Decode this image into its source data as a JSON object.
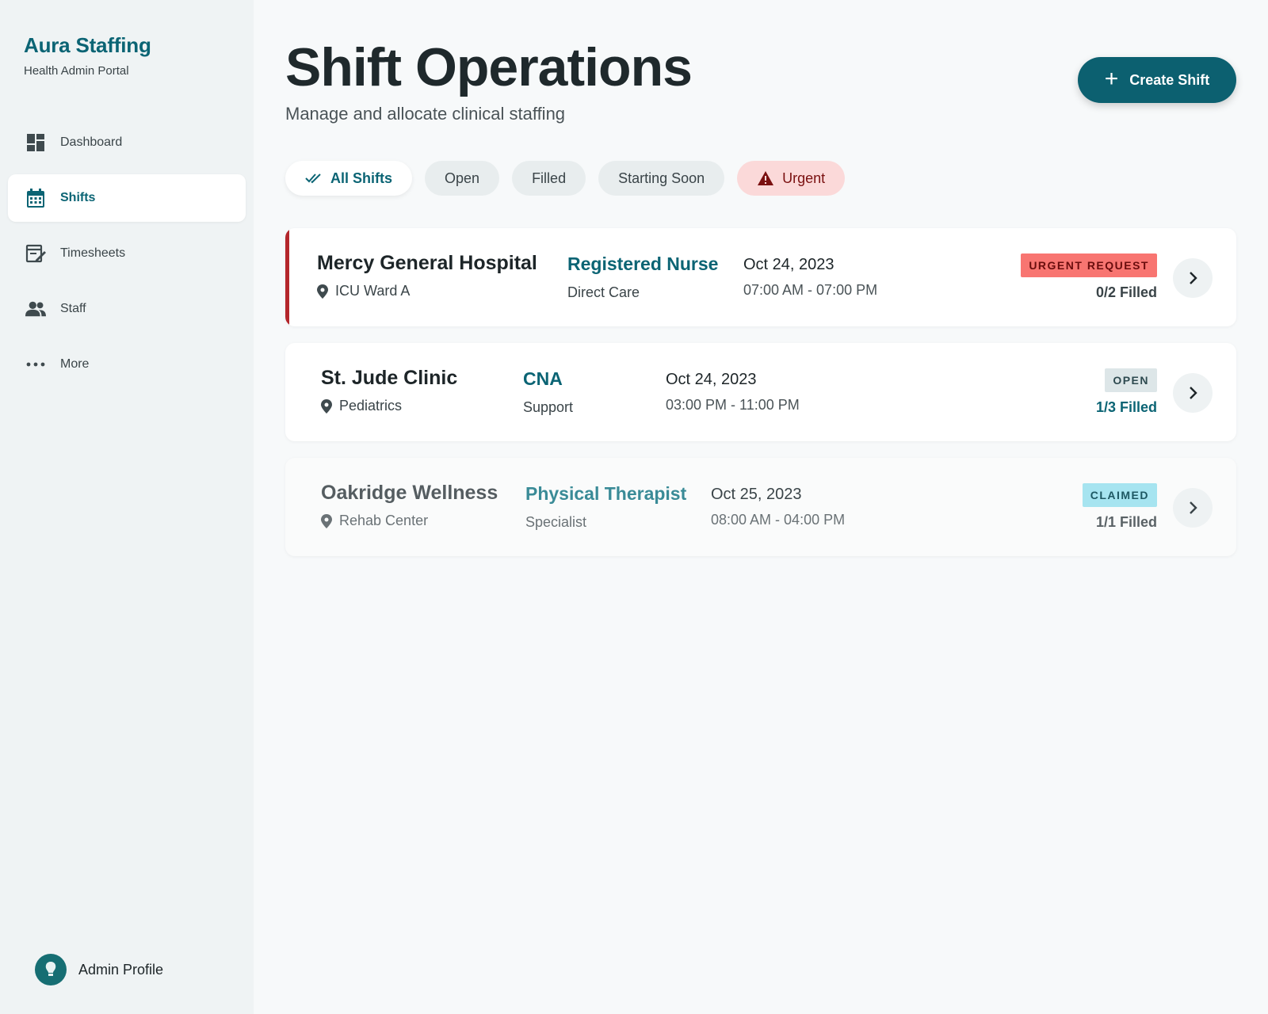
{
  "brand": {
    "name": "Aura Staffing",
    "subtitle": "Health Admin Portal"
  },
  "nav": [
    {
      "label": "Dashboard",
      "icon": "dashboard-icon",
      "active": false
    },
    {
      "label": "Shifts",
      "icon": "calendar-icon",
      "active": true
    },
    {
      "label": "Timesheets",
      "icon": "timesheet-icon",
      "active": false
    },
    {
      "label": "Staff",
      "icon": "people-icon",
      "active": false
    },
    {
      "label": "More",
      "icon": "more-icon",
      "active": false
    }
  ],
  "profile": {
    "name": "Admin Profile"
  },
  "header": {
    "title": "Shift Operations",
    "subtitle": "Manage and allocate clinical staffing",
    "create_label": "Create Shift"
  },
  "filters": [
    {
      "label": "All Shifts",
      "active": true
    },
    {
      "label": "Open",
      "active": false
    },
    {
      "label": "Filled",
      "active": false
    },
    {
      "label": "Starting Soon",
      "active": false
    },
    {
      "label": "Urgent",
      "active": false
    }
  ],
  "shifts": [
    {
      "facility": "Mercy General Hospital",
      "location": "ICU Ward A",
      "role": "Registered Nurse",
      "role_type": "Direct Care",
      "date": "Oct 24, 2023",
      "time": "07:00 AM - 07:00 PM",
      "status": "URGENT REQUEST",
      "filled": "0/2 Filled"
    },
    {
      "facility": "St. Jude Clinic",
      "location": "Pediatrics",
      "role": "CNA",
      "role_type": "Support",
      "date": "Oct 24, 2023",
      "time": "03:00 PM - 11:00 PM",
      "status": "OPEN",
      "filled": "1/3 Filled"
    },
    {
      "facility": "Oakridge Wellness",
      "location": "Rehab Center",
      "role": "Physical Therapist",
      "role_type": "Specialist",
      "date": "Oct 25, 2023",
      "time": "08:00 AM - 04:00 PM",
      "status": "CLAIMED",
      "filled": "1/1 Filled"
    }
  ],
  "colors": {
    "brand": "#0b6474",
    "urgent_accent": "#b3262b",
    "urgent_badge": "#f87571",
    "claimed_badge": "#a6e4f0"
  }
}
